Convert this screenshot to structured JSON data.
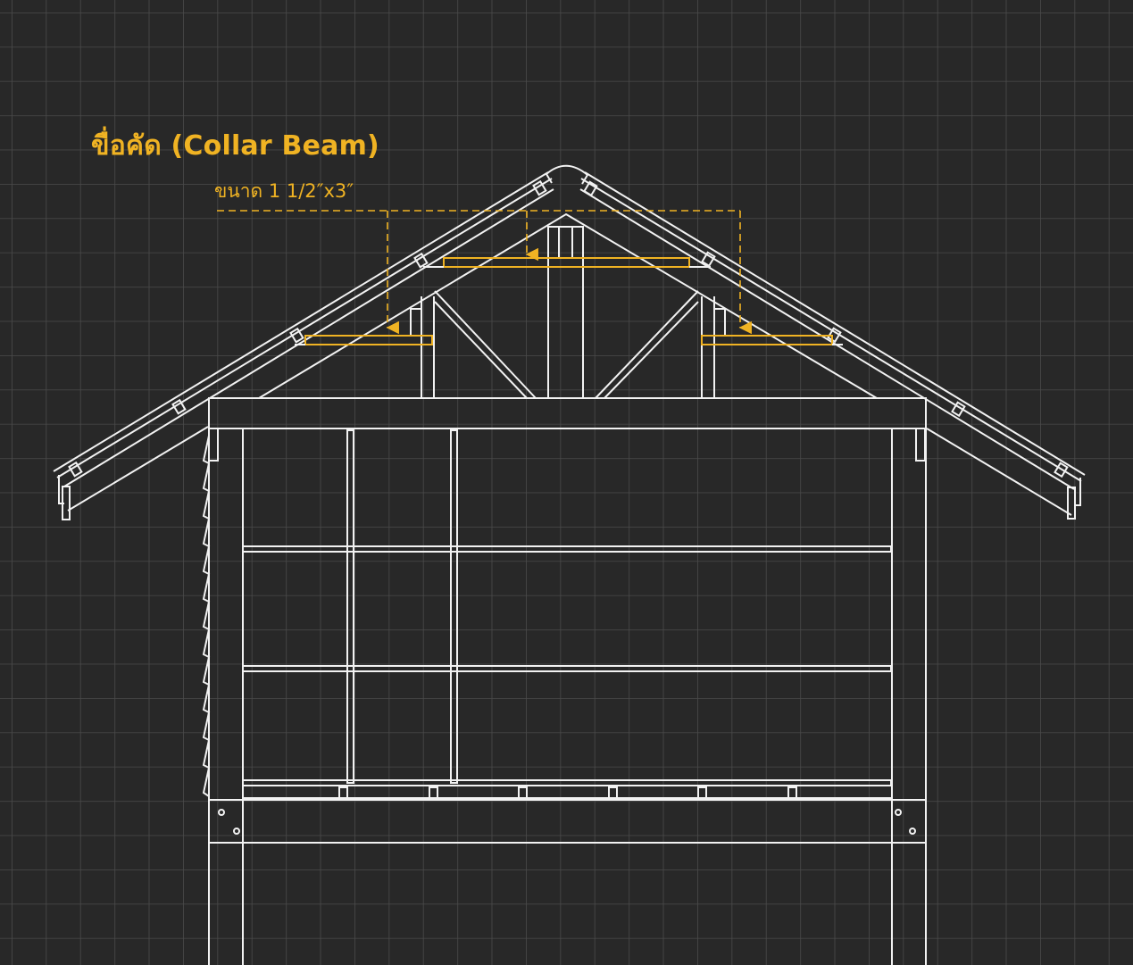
{
  "annotation": {
    "title": "ขื่อคัด (Collar Beam)",
    "size": "ขนาด 1 1/2″x3″"
  },
  "colors": {
    "background": "#282828",
    "grid": "#4a4a4a",
    "line": "#f2f2f2",
    "highlight": "#f0b323"
  }
}
